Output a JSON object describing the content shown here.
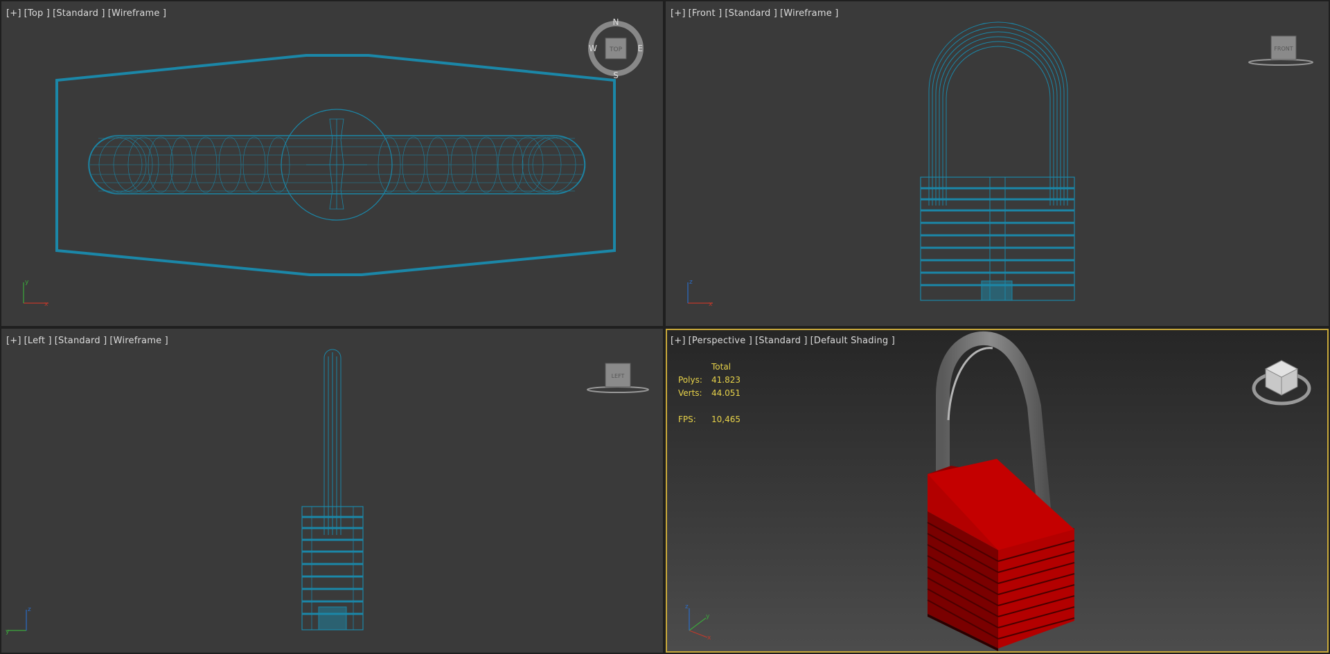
{
  "viewports": {
    "top": {
      "labels": [
        "[+]",
        "[Top ]",
        "[Standard ]",
        "[Wireframe ]"
      ],
      "cube": "TOP",
      "compass": {
        "n": "N",
        "s": "S",
        "e": "E",
        "w": "W"
      },
      "axis": {
        "a": "x",
        "b": "y"
      }
    },
    "front": {
      "labels": [
        "[+]",
        "[Front ]",
        "[Standard ]",
        "[Wireframe ]"
      ],
      "cube": "FRONT",
      "axis": {
        "a": "x",
        "b": "z"
      }
    },
    "left": {
      "labels": [
        "[+]",
        "[Left ]",
        "[Standard ]",
        "[Wireframe ]"
      ],
      "cube": "LEFT",
      "axis": {
        "a": "y",
        "b": "z"
      }
    },
    "perspective": {
      "labels": [
        "[+]",
        "[Perspective ]",
        "[Standard ]",
        "[Default Shading ]"
      ],
      "stats": {
        "header": "Total",
        "polys_label": "Polys:",
        "polys": "41.823",
        "verts_label": "Verts:",
        "verts": "44.051",
        "fps_label": "FPS:",
        "fps": "10,465"
      },
      "axis": {
        "x": "x",
        "y": "y",
        "z": "z"
      }
    }
  },
  "colors": {
    "wire": "#1b87a8",
    "accent": "#c8a83a",
    "lock_body": "#a10000",
    "shackle": "#7a7a7a",
    "stats": "#e8d34a"
  }
}
